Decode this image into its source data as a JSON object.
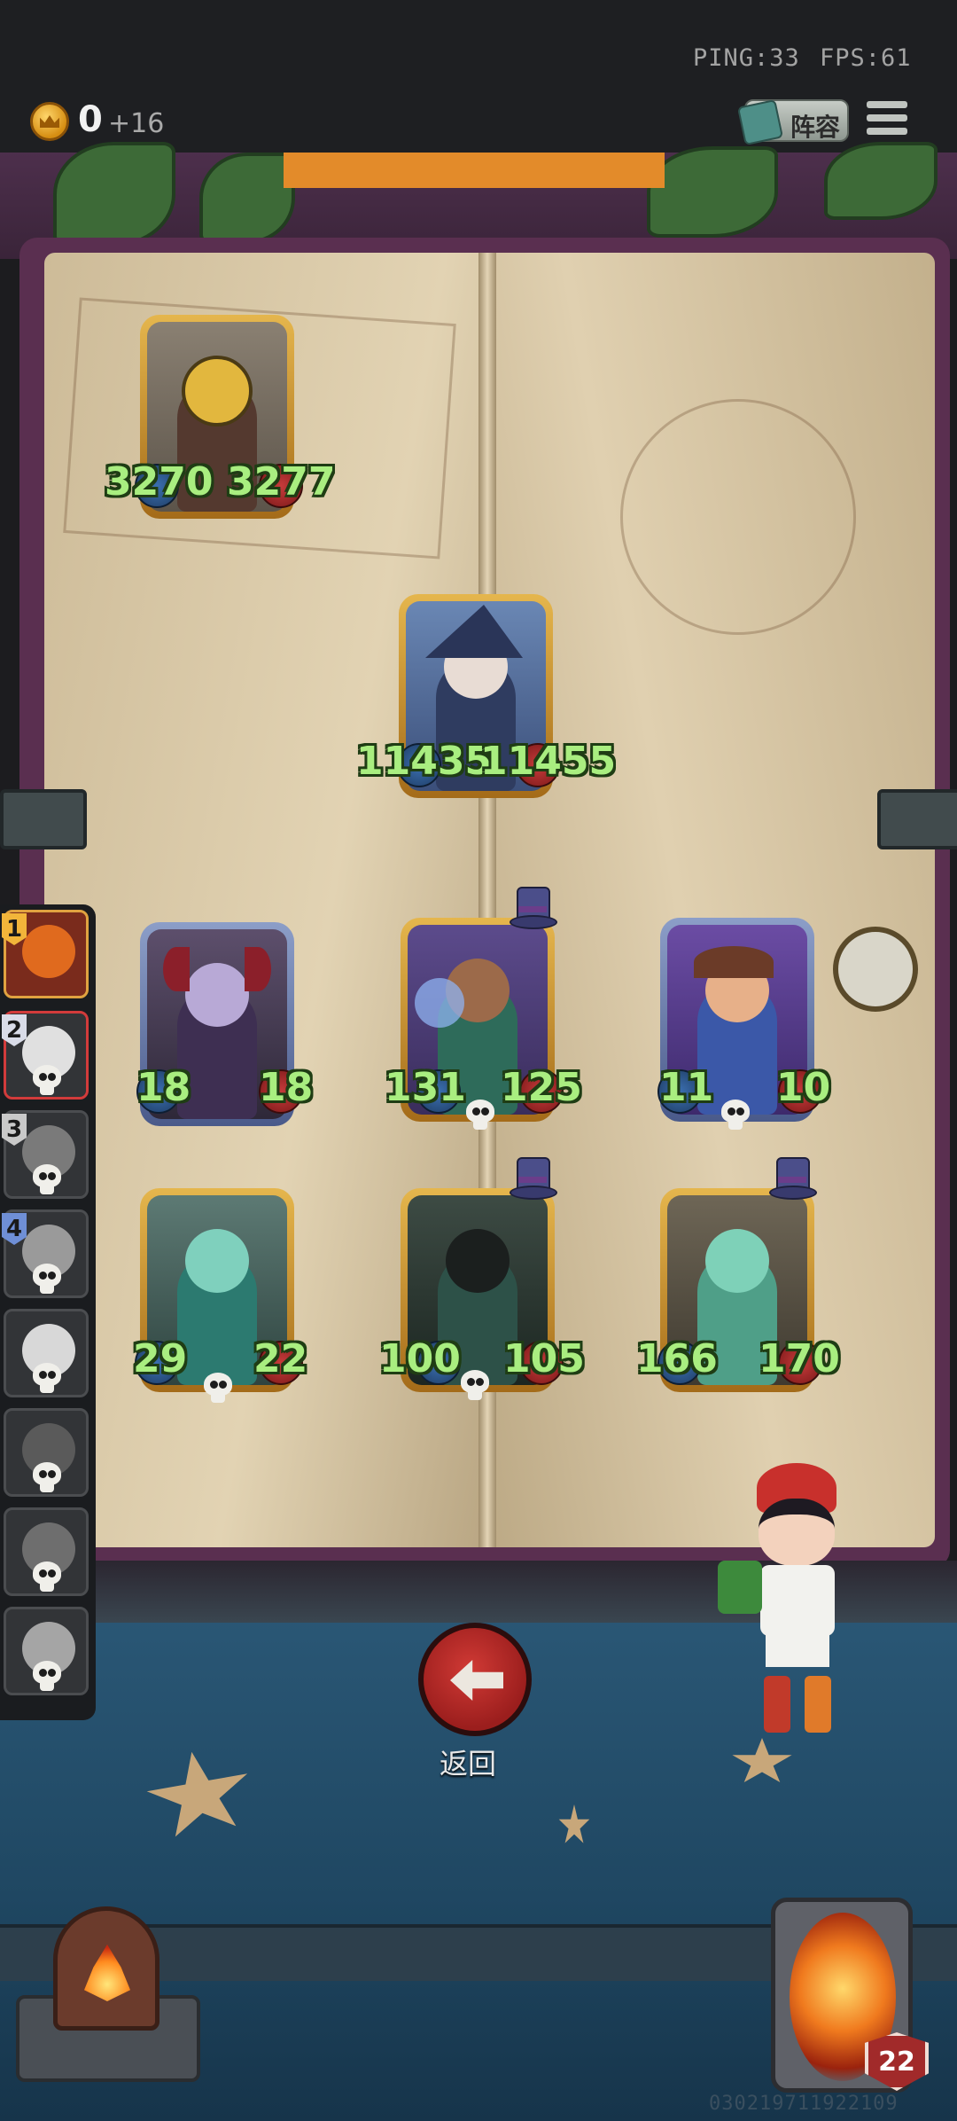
{
  "topbar": {
    "ping": "PING:33",
    "fps": "FPS:61",
    "gold": "0",
    "gold_income": "+16",
    "lineup_label": "阵容"
  },
  "board": {
    "units": [
      {
        "id": "robot",
        "attack": "3270",
        "health": "3277",
        "frame": "gold"
      },
      {
        "id": "wizard",
        "attack": "11435",
        "health": "11455",
        "frame": "gold"
      },
      {
        "id": "imp",
        "attack": "18",
        "health": "18",
        "frame": "blue"
      },
      {
        "id": "mystic",
        "attack": "131",
        "health": "125",
        "frame": "gold"
      },
      {
        "id": "jester",
        "attack": "11",
        "health": "10",
        "frame": "blue"
      },
      {
        "id": "bottle",
        "attack": "29",
        "health": "22",
        "frame": "gold"
      },
      {
        "id": "shadow",
        "attack": "100",
        "health": "105",
        "frame": "gold"
      },
      {
        "id": "captain",
        "attack": "166",
        "health": "170",
        "frame": "gold"
      }
    ]
  },
  "roster": {
    "slots": [
      {
        "num": "1",
        "color": "#f2b53a"
      },
      {
        "num": "2",
        "color": "#d9dce8"
      },
      {
        "num": "3",
        "color": "#c9c9c9"
      },
      {
        "num": "4",
        "color": "#6f8fd6"
      },
      {
        "num": "",
        "color": ""
      },
      {
        "num": "",
        "color": ""
      },
      {
        "num": "",
        "color": ""
      },
      {
        "num": "",
        "color": ""
      }
    ]
  },
  "back_label": "返回",
  "hero": {
    "level": "22"
  },
  "uid": "030219711922109",
  "colors": {
    "stat_text": "#a9ee80",
    "back_button": "#c0302c",
    "stage": "#2c5a79"
  }
}
